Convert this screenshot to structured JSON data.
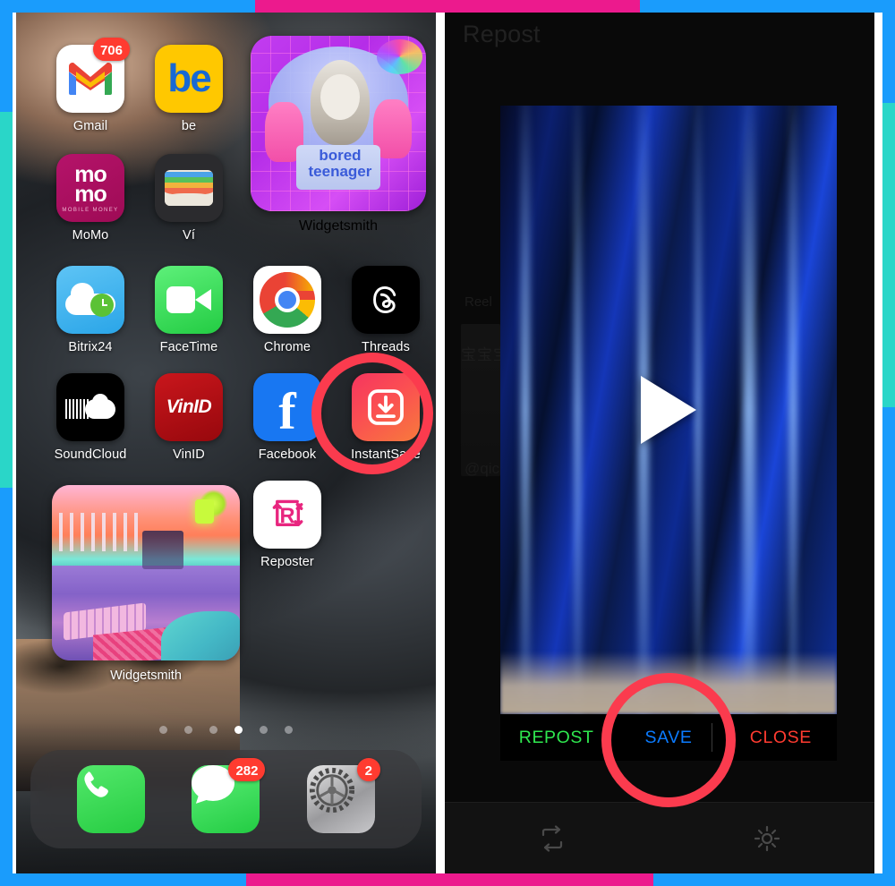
{
  "frame": {
    "color_blue": "#1a9cfc",
    "color_pink": "#ec1a8d",
    "color_teal": "#2ad6c8",
    "annotation_color": "#fb3b4e"
  },
  "left_phone": {
    "name": "ios-home-screen",
    "apps": [
      {
        "label": "Gmail",
        "icon": "gmail-icon",
        "badge": "706"
      },
      {
        "label": "be",
        "icon": "be-icon",
        "badge": ""
      },
      {
        "label": "Widgetsmith",
        "icon": "widgetsmith-widget-icon",
        "badge": ""
      },
      {
        "label": "MoMo",
        "icon": "momo-icon",
        "badge": ""
      },
      {
        "label": "Ví",
        "icon": "wallet-icon",
        "badge": ""
      },
      {
        "label": "Bitrix24",
        "icon": "bitrix24-icon",
        "badge": ""
      },
      {
        "label": "FaceTime",
        "icon": "facetime-icon",
        "badge": ""
      },
      {
        "label": "Chrome",
        "icon": "chrome-icon",
        "badge": ""
      },
      {
        "label": "Threads",
        "icon": "threads-icon",
        "badge": ""
      },
      {
        "label": "SoundCloud",
        "icon": "soundcloud-icon",
        "badge": ""
      },
      {
        "label": "VinID",
        "icon": "vinid-icon",
        "badge": ""
      },
      {
        "label": "Facebook",
        "icon": "facebook-icon",
        "badge": ""
      },
      {
        "label": "InstantSave",
        "icon": "instantsave-icon",
        "badge": ""
      },
      {
        "label": "Reposter",
        "icon": "reposter-icon",
        "badge": ""
      }
    ],
    "widget": {
      "label": "Widgetsmith",
      "icon": "widgetsmith-photo-widget"
    },
    "page_dots": {
      "total": 6,
      "active_index": 4
    },
    "dock": [
      {
        "label": "Phone",
        "icon": "phone-icon",
        "badge": ""
      },
      {
        "label": "Messages",
        "icon": "messages-icon",
        "badge": "282"
      },
      {
        "label": "Settings",
        "icon": "settings-gear-icon",
        "badge": "2"
      }
    ]
  },
  "right_phone": {
    "name": "repost-app",
    "title": "Repost",
    "background_list": {
      "section_label": "Reel",
      "caption": "宝宝宝",
      "username": "@qic"
    },
    "player": {
      "play_icon": "play-icon",
      "state": "paused"
    },
    "actions": [
      {
        "label": "REPOST",
        "color": "#2fe84f",
        "name": "repost-button"
      },
      {
        "label": "SAVE",
        "color": "#0b7bff",
        "name": "save-button"
      },
      {
        "label": "CLOSE",
        "color": "#ff3b30",
        "name": "close-button"
      }
    ],
    "tabs": [
      {
        "icon": "repost-loop-icon",
        "name": "tab-repost"
      },
      {
        "icon": "gear-icon",
        "name": "tab-settings"
      }
    ]
  },
  "annotations": [
    {
      "target": "InstantSave",
      "shape": "circle",
      "color": "#fb3b4e"
    },
    {
      "target": "SAVE",
      "shape": "circle",
      "color": "#fb3b4e"
    }
  ]
}
